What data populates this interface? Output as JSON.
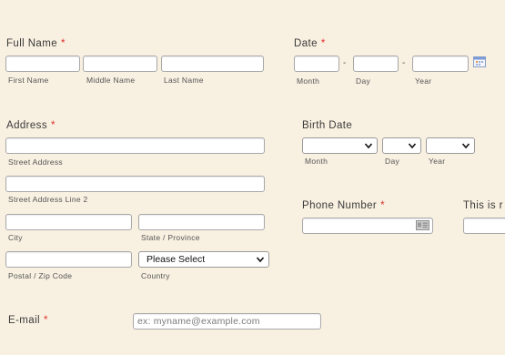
{
  "full_name": {
    "label": "Full Name",
    "required_mark": "*",
    "first": "First Name",
    "middle": "Middle Name",
    "last": "Last Name"
  },
  "date": {
    "label": "Date",
    "required_mark": "*",
    "separator": "-",
    "month": "Month",
    "day": "Day",
    "year": "Year",
    "icon": "calendar-icon"
  },
  "address": {
    "label": "Address",
    "required_mark": "*",
    "street": "Street Address",
    "street2": "Street Address Line 2",
    "city": "City",
    "state": "State / Province",
    "postal": "Postal / Zip Code",
    "country": "Country",
    "country_value": "Please Select"
  },
  "birth_date": {
    "label": "Birth Date",
    "month": "Month",
    "day": "Day",
    "year": "Year"
  },
  "phone": {
    "label": "Phone Number",
    "required_mark": "*",
    "icon": "contact-card-icon"
  },
  "extra": {
    "label": "This is r"
  },
  "email": {
    "label": "E-mail",
    "required_mark": "*",
    "placeholder": "ex: myname@example.com"
  },
  "colors": {
    "background": "#f8f0e1",
    "required": "#e0342f"
  }
}
